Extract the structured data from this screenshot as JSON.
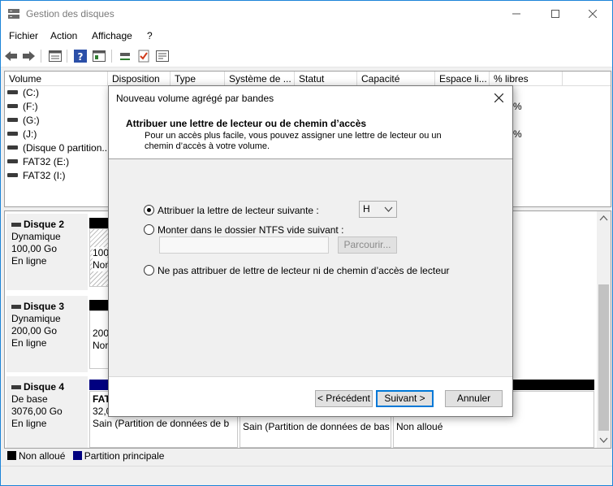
{
  "window": {
    "title": "Gestion des disques"
  },
  "menu": [
    "Fichier",
    "Action",
    "Affichage",
    "?"
  ],
  "columns": [
    "Volume",
    "Disposition",
    "Type",
    "Système de ...",
    "Statut",
    "Capacité",
    "Espace li...",
    "% libres"
  ],
  "volumes": [
    "(C:)",
    "(F:)",
    "(G:)",
    "(J:)",
    "(Disque 0 partition...",
    "FAT32 (E:)",
    "FAT32 (I:)"
  ],
  "pct_fragments": [
    "%",
    "%"
  ],
  "disks": [
    {
      "name": "Disque 2",
      "type": "Dynamique",
      "size": "100,00 Go",
      "status": "En ligne",
      "partition_line1": "100",
      "partition_line2": "Nor"
    },
    {
      "name": "Disque 3",
      "type": "Dynamique",
      "size": "200,00 Go",
      "status": "En ligne",
      "partition_line1": "200",
      "partition_line2": "Nor"
    },
    {
      "name": "Disque 4",
      "type": "De base",
      "size": "3076,00 Go",
      "status": "En ligne"
    }
  ],
  "disk4_partitions": [
    {
      "title": "FAT",
      "size": "32,0",
      "desc": "Sain (Partition de données de b"
    },
    {
      "title": "",
      "size": "",
      "desc": "Sain (Partition de données de bas"
    },
    {
      "title": "",
      "size": "",
      "desc": "Non alloué"
    }
  ],
  "legend": {
    "unallocated": "Non alloué",
    "primary": "Partition principale"
  },
  "colors": {
    "unallocated": "#000000",
    "primary": "#000080",
    "accent": "#0078d7"
  },
  "dialog": {
    "title": "Nouveau volume agrégé par bandes",
    "heading": "Attribuer une lettre de lecteur ou de chemin d’accès",
    "description": "Pour un accès plus facile, vous pouvez assigner une lettre de lecteur ou un chemin d’accès à votre volume.",
    "option_assign": "Attribuer la lettre de lecteur suivante :",
    "drive_letter": "H",
    "option_mount": "Monter dans le dossier NTFS vide suivant :",
    "browse": "Parcourir...",
    "option_none": "Ne pas attribuer de lettre de lecteur ni de chemin d’accès de lecteur",
    "btn_back": "< Précédent",
    "btn_next": "Suivant >",
    "btn_cancel": "Annuler"
  }
}
